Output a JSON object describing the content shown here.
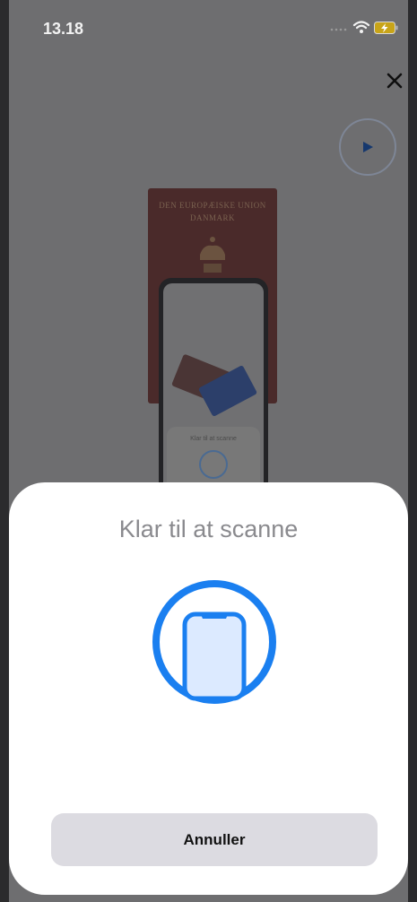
{
  "status_bar": {
    "time": "13.18",
    "icons": [
      "signal-dots-icon",
      "wifi-icon",
      "battery-charging-icon"
    ]
  },
  "header": {
    "close_icon": "close-icon",
    "play_icon": "play-icon"
  },
  "illustration": {
    "passport_line_1": "DEN EUROPÆISKE UNION",
    "passport_line_2": "DANMARK",
    "mini_sheet_title": "Klar til at scanne"
  },
  "sheet": {
    "title": "Klar til at scanne",
    "icon": "phone-scan-icon",
    "cancel_label": "Annuller"
  },
  "colors": {
    "accent": "#1a7ff0",
    "sheet_background": "#ffffff",
    "button_background": "#dcdbe1",
    "dimmed_background": "#6e6e70"
  }
}
